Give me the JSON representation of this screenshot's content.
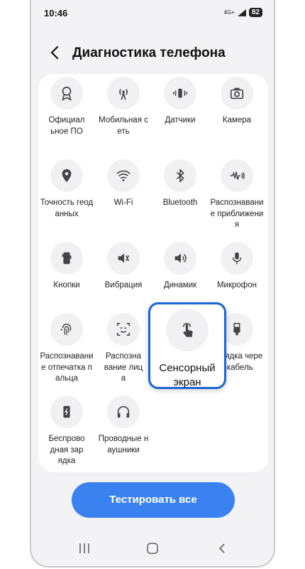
{
  "status": {
    "time": "10:46",
    "network": "4G+",
    "battery": "82"
  },
  "header": {
    "title": "Диагностика телефона"
  },
  "tiles": [
    {
      "label": "Официальное ПО",
      "icon": "badge-icon"
    },
    {
      "label": "Мобильная сеть",
      "icon": "antenna-icon"
    },
    {
      "label": "Датчики",
      "icon": "vibrate-sensor-icon"
    },
    {
      "label": "Камера",
      "icon": "camera-icon"
    },
    {
      "label": "Точность геоданных",
      "icon": "location-icon"
    },
    {
      "label": "Wi-Fi",
      "icon": "wifi-icon"
    },
    {
      "label": "Bluetooth",
      "icon": "bluetooth-icon"
    },
    {
      "label": "Распознавание приближения",
      "icon": "proximity-icon"
    },
    {
      "label": "Кнопки",
      "icon": "phone-buttons-icon"
    },
    {
      "label": "Вибрация",
      "icon": "vibration-icon"
    },
    {
      "label": "Динамик",
      "icon": "speaker-icon"
    },
    {
      "label": "Микрофон",
      "icon": "microphone-icon"
    },
    {
      "label": "Распознавание отпечатка пальца",
      "icon": "fingerprint-icon"
    },
    {
      "label": "Распознавание лица",
      "icon": "face-icon"
    },
    {
      "label": "Сенсорный экран",
      "icon": "touch-icon"
    },
    {
      "label": "Зарядка через кабель",
      "icon": "usb-icon"
    },
    {
      "label": "Беспроводная зарядка",
      "icon": "wireless-charging-icon"
    },
    {
      "label": "Проводные наушники",
      "icon": "headphones-icon"
    }
  ],
  "highlight": {
    "label": "Сенсорный экран"
  },
  "action": {
    "label": "Тестировать все"
  }
}
